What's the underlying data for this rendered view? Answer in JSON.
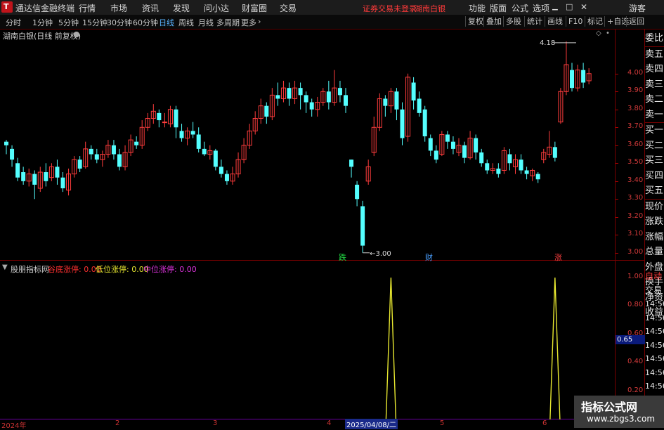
{
  "app": {
    "title": "通达信金融终端",
    "menu": [
      "行情",
      "市场",
      "资讯",
      "发现",
      "问小达",
      "财富圈",
      "交易"
    ],
    "login_status": "证券交易未登录",
    "stock_name": "湖南白银",
    "right_menu": [
      "功能",
      "版面",
      "公式",
      "选项"
    ],
    "guest": "游客"
  },
  "periods": [
    "分时",
    "1分钟",
    "5分钟",
    "15分钟",
    "30分钟",
    "60分钟",
    "日线",
    "周线",
    "月线",
    "多周期",
    "更多"
  ],
  "active_period": "日线",
  "tools": [
    "复权",
    "叠加",
    "多股",
    "统计",
    "画线",
    "F10",
    "标记",
    "+自选",
    "返回"
  ],
  "chart_header": "湖南白银(日线 前复权)",
  "kline_yaxis": [
    "4.00",
    "3.90",
    "3.80",
    "3.70",
    "3.60",
    "3.50",
    "3.40",
    "3.30",
    "3.20",
    "3.10",
    "3.00"
  ],
  "price_high_label": "4.18",
  "price_low_label": "3.00",
  "markers": [
    {
      "text": "跌",
      "color": "#22dd44"
    },
    {
      "text": "财",
      "color": "#4aa0ff"
    },
    {
      "text": "涨",
      "color": "#ff4040"
    }
  ],
  "indicator": {
    "name": "股朋指标网",
    "items": [
      {
        "label": "谷底涨停:",
        "value": "0.00",
        "color": "#ff3030"
      },
      {
        "label": "低位涨停:",
        "value": "0.00",
        "color": "#e8e830"
      },
      {
        "label": "中位涨停:",
        "value": "0.00",
        "color": "#dd33dd"
      }
    ]
  },
  "ind_yaxis": [
    "1.00",
    "0.80",
    "0.60",
    "0.40",
    "0.20"
  ],
  "cursor_value": "0.65",
  "xaxis": [
    "2024年",
    "2",
    "3",
    "4",
    "2025/04/08/二",
    "5",
    "6"
  ],
  "right_labels": [
    "委比",
    "卖五",
    "卖四",
    "卖三",
    "卖二",
    "卖一",
    "买一",
    "买二",
    "买三",
    "买四",
    "买五",
    "现价",
    "涨跌",
    "涨幅",
    "总量",
    "外盘",
    "换手",
    "净资",
    "收益"
  ],
  "right_bottom": [
    "自动",
    "交易",
    "14:56",
    "14:56",
    "14:56",
    "14:56",
    "14:56",
    "14:56",
    "14:56",
    "14:56"
  ],
  "watermark": {
    "title": "指标公式网",
    "url": "www.zbgs3.com"
  },
  "chart_data": {
    "type": "candlestick",
    "ylim": [
      2.96,
      4.25
    ],
    "candles": [
      [
        3.62,
        3.6,
        3.63,
        3.55
      ],
      [
        3.58,
        3.52,
        3.6,
        3.48
      ],
      [
        3.5,
        3.42,
        3.53,
        3.4
      ],
      [
        3.45,
        3.4,
        3.48,
        3.38
      ],
      [
        3.4,
        3.44,
        3.47,
        3.37
      ],
      [
        3.44,
        3.38,
        3.46,
        3.3
      ],
      [
        3.36,
        3.45,
        3.48,
        3.34
      ],
      [
        3.45,
        3.4,
        3.5,
        3.37
      ],
      [
        3.42,
        3.48,
        3.5,
        3.4
      ],
      [
        3.48,
        3.42,
        3.52,
        3.38
      ],
      [
        3.42,
        3.36,
        3.45,
        3.34
      ],
      [
        3.35,
        3.44,
        3.47,
        3.32
      ],
      [
        3.44,
        3.52,
        3.54,
        3.42
      ],
      [
        3.52,
        3.47,
        3.54,
        3.45
      ],
      [
        3.48,
        3.58,
        3.62,
        3.47
      ],
      [
        3.58,
        3.55,
        3.6,
        3.52
      ],
      [
        3.55,
        3.52,
        3.58,
        3.5
      ],
      [
        3.52,
        3.55,
        3.57,
        3.48
      ],
      [
        3.55,
        3.6,
        3.63,
        3.53
      ],
      [
        3.6,
        3.55,
        3.63,
        3.52
      ],
      [
        3.55,
        3.48,
        3.58,
        3.46
      ],
      [
        3.48,
        3.56,
        3.6,
        3.46
      ],
      [
        3.56,
        3.63,
        3.66,
        3.54
      ],
      [
        3.62,
        3.6,
        3.65,
        3.58
      ],
      [
        3.6,
        3.7,
        3.74,
        3.58
      ],
      [
        3.7,
        3.75,
        3.78,
        3.68
      ],
      [
        3.75,
        3.79,
        3.83,
        3.72
      ],
      [
        3.78,
        3.74,
        3.8,
        3.7
      ],
      [
        3.73,
        3.73,
        3.78,
        3.7
      ],
      [
        3.72,
        3.8,
        3.82,
        3.7
      ],
      [
        3.8,
        3.7,
        3.82,
        3.64
      ],
      [
        3.68,
        3.64,
        3.72,
        3.62
      ],
      [
        3.64,
        3.68,
        3.7,
        3.6
      ],
      [
        3.68,
        3.66,
        3.73,
        3.64
      ],
      [
        3.66,
        3.58,
        3.7,
        3.56
      ],
      [
        3.58,
        3.55,
        3.62,
        3.54
      ],
      [
        3.55,
        3.57,
        3.6,
        3.52
      ],
      [
        3.57,
        3.48,
        3.58,
        3.46
      ],
      [
        3.48,
        3.44,
        3.52,
        3.42
      ],
      [
        3.44,
        3.4,
        3.46,
        3.38
      ],
      [
        3.4,
        3.44,
        3.48,
        3.38
      ],
      [
        3.44,
        3.52,
        3.56,
        3.42
      ],
      [
        3.52,
        3.6,
        3.64,
        3.5
      ],
      [
        3.6,
        3.68,
        3.72,
        3.58
      ],
      [
        3.68,
        3.75,
        3.79,
        3.66
      ],
      [
        3.75,
        3.82,
        3.86,
        3.72
      ],
      [
        3.82,
        3.76,
        3.84,
        3.72
      ],
      [
        3.76,
        3.88,
        3.92,
        3.74
      ],
      [
        3.88,
        3.86,
        3.95,
        3.82
      ],
      [
        3.86,
        3.92,
        3.96,
        3.84
      ],
      [
        3.92,
        3.86,
        3.95,
        3.82
      ],
      [
        3.86,
        3.92,
        3.96,
        3.83
      ],
      [
        3.92,
        3.88,
        3.95,
        3.8
      ],
      [
        3.88,
        3.84,
        3.9,
        3.78
      ],
      [
        3.84,
        3.8,
        3.86,
        3.76
      ],
      [
        3.8,
        3.84,
        3.87,
        3.76
      ],
      [
        3.84,
        3.9,
        3.92,
        3.82
      ],
      [
        3.9,
        3.84,
        3.96,
        3.8
      ],
      [
        3.84,
        3.92,
        4.02,
        3.82
      ],
      [
        3.92,
        3.88,
        3.96,
        3.84
      ],
      [
        3.88,
        3.82,
        3.92,
        3.78
      ],
      [
        3.52,
        3.48,
        3.52,
        3.42
      ],
      [
        3.38,
        3.3,
        3.4,
        3.26
      ],
      [
        3.26,
        3.04,
        3.29,
        3.0
      ],
      [
        3.4,
        3.48,
        3.52,
        3.38
      ],
      [
        3.56,
        3.7,
        3.76,
        3.54
      ],
      [
        3.7,
        3.86,
        3.89,
        3.68
      ],
      [
        3.86,
        3.82,
        3.88,
        3.76
      ],
      [
        3.82,
        3.9,
        3.92,
        3.78
      ],
      [
        3.9,
        3.8,
        3.92,
        3.74
      ],
      [
        3.8,
        3.64,
        3.84,
        3.6
      ],
      [
        3.65,
        3.98,
        4.0,
        3.62
      ],
      [
        3.95,
        3.85,
        3.98,
        3.8
      ],
      [
        3.86,
        3.78,
        3.9,
        3.76
      ],
      [
        3.8,
        3.65,
        3.82,
        3.62
      ],
      [
        3.64,
        3.57,
        3.66,
        3.54
      ],
      [
        3.57,
        3.52,
        3.6,
        3.5
      ],
      [
        3.55,
        3.66,
        3.68,
        3.54
      ],
      [
        3.66,
        3.62,
        3.68,
        3.58
      ],
      [
        3.62,
        3.58,
        3.65,
        3.55
      ],
      [
        3.56,
        3.6,
        3.64,
        3.54
      ],
      [
        3.6,
        3.53,
        3.62,
        3.5
      ],
      [
        3.53,
        3.64,
        3.68,
        3.52
      ],
      [
        3.64,
        3.56,
        3.66,
        3.52
      ],
      [
        3.56,
        3.5,
        3.58,
        3.48
      ],
      [
        3.5,
        3.46,
        3.52,
        3.44
      ],
      [
        3.46,
        3.47,
        3.5,
        3.44
      ],
      [
        3.47,
        3.44,
        3.5,
        3.42
      ],
      [
        3.46,
        3.57,
        3.59,
        3.44
      ],
      [
        3.55,
        3.5,
        3.58,
        3.46
      ],
      [
        3.48,
        3.52,
        3.55,
        3.44
      ],
      [
        3.52,
        3.46,
        3.55,
        3.44
      ],
      [
        3.46,
        3.44,
        3.48,
        3.41
      ],
      [
        3.43,
        3.46,
        3.47,
        3.4
      ],
      [
        3.44,
        3.41,
        3.45,
        3.39
      ],
      [
        3.52,
        3.56,
        3.58,
        3.5
      ],
      [
        3.55,
        3.59,
        3.68,
        3.53
      ],
      [
        3.59,
        3.53,
        3.62,
        3.51
      ],
      [
        3.73,
        3.9,
        3.92,
        3.72
      ],
      [
        3.9,
        4.05,
        4.18,
        3.88
      ],
      [
        4.02,
        3.92,
        4.06,
        3.9
      ],
      [
        3.92,
        4.02,
        4.05,
        3.9
      ],
      [
        4.02,
        3.95,
        4.06,
        3.92
      ],
      [
        3.96,
        4.0,
        4.03,
        3.94
      ]
    ],
    "indicator_ylim": [
      0,
      1.05
    ],
    "indicator_spikes": [
      {
        "index": 68,
        "value": 1.0
      },
      {
        "index": 97,
        "value": 1.0
      }
    ]
  }
}
